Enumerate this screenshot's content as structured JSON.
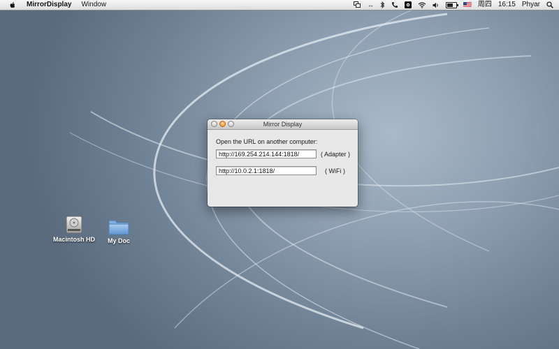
{
  "menubar": {
    "app_name": "MirrorDisplay",
    "menus": [
      "Window"
    ],
    "status": {
      "weekday": "周四",
      "time": "16:15",
      "user": "Phyar",
      "battery_fraction": 0.7
    }
  },
  "window": {
    "title": "Mirror Display",
    "prompt": "Open the URL on another computer:",
    "entries": [
      {
        "url": "http://169.254.214.144:1818/",
        "label": "( Adapter )"
      },
      {
        "url": "http://10.0.2.1:1818/",
        "label": "( WiFi )"
      }
    ]
  },
  "desktop_icons": [
    {
      "label": "Macintosh HD",
      "icon": "hard-drive-icon"
    },
    {
      "label": "My Doc",
      "icon": "folder-icon"
    }
  ],
  "colors": {
    "wallpaper": "#7f91a4",
    "zoom_button": "#f08a14"
  }
}
